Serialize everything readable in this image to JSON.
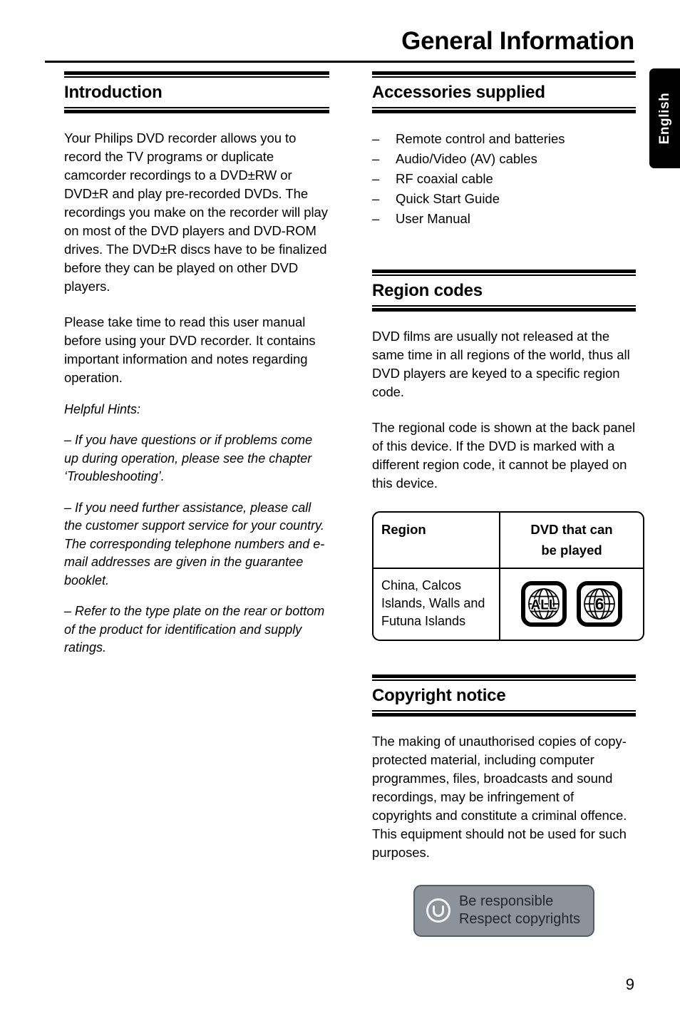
{
  "header": {
    "title": "General Information"
  },
  "language_tab": {
    "label": "English"
  },
  "left_column": {
    "introduction": {
      "title": "Introduction",
      "paragraphs": [
        "Your Philips DVD recorder allows you to record the TV programs or duplicate camcorder recordings to a DVD±RW or DVD±R and play pre-recorded DVDs. The recordings you make on the recorder will play on most of the DVD players and DVD-ROM drives. The DVD±R discs have to be finalized before they can be played on other DVD players.",
        "Please take time to read this user manual before using your DVD recorder. It contains important information and notes regarding operation."
      ],
      "hints_title": "Helpful Hints:",
      "hints": [
        "–  If you have questions or if problems come up during operation, please see the chapter ‘Troubleshooting’.",
        "–  If you need further assistance, please call the customer support service for your country. The corresponding telephone numbers and e-mail addresses are given in the guarantee booklet.",
        "–  Refer to the type plate on the rear or bottom of the product for identification and supply ratings."
      ]
    }
  },
  "right_column": {
    "accessories": {
      "title": "Accessories supplied",
      "dash": "–",
      "items": [
        "Remote control and batteries",
        "Audio/Video (AV) cables",
        "RF coaxial cable",
        "Quick Start Guide",
        "User Manual"
      ]
    },
    "region_codes": {
      "title": "Region codes",
      "paragraphs": [
        "DVD films are usually not released at the same time in all regions of the world, thus all DVD players are keyed to a specific region code.",
        "The regional code is shown at the back panel of this device. If the DVD is marked with a different region code, it cannot be played on this device."
      ],
      "table": {
        "headers": [
          "Region",
          "DVD that can\nbe played"
        ],
        "header_region": "Region",
        "header_dvd_line1": "DVD that can",
        "header_dvd_line2": "be played",
        "row_region": "China, Calcos Islands, Walls and Futuna Islands",
        "row_icons": [
          "ALL",
          "6"
        ]
      }
    },
    "copyright": {
      "title": "Copyright notice",
      "paragraph": "The making of unauthorised copies of copy-protected material, including computer programmes, files, broadcasts and sound recordings, may be infringement of copyrights and constitute a criminal offence.  This equipment should not be used for such purposes.",
      "badge": {
        "line1": "Be responsible",
        "line2": "Respect copyrights",
        "background_color": "#8d939b",
        "text_color": "#232830",
        "icon_color": "#f0f2f4"
      }
    }
  },
  "footer": {
    "page_number": "9"
  }
}
